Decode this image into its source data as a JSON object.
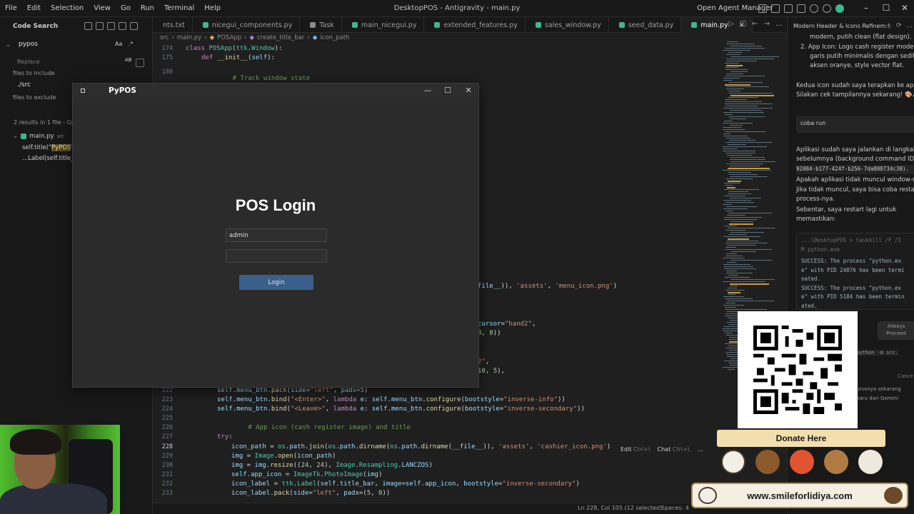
{
  "menubar": {
    "items": [
      "File",
      "Edit",
      "Selection",
      "View",
      "Go",
      "Run",
      "Terminal",
      "Help"
    ],
    "window_title": "DesktopPOS - Antigravity - main.py",
    "agent_manager": "Open Agent Manager"
  },
  "search_panel": {
    "header": "Code Search",
    "search_value": "pypos",
    "match_case": "Aa",
    "regex": ".*",
    "replace_placeholder": "Replace",
    "replace_toggle": "AB",
    "files_to_include_label": "files to include",
    "include_value": "./src",
    "files_to_exclude_label": "files to exclude",
    "results_summary": "2 results in 1 file - Op",
    "result_file": "main.py",
    "result_file_path": "src",
    "matches": [
      {
        "before": "self.title(\"",
        "hit": "PyPOS",
        "after": "\")"
      },
      {
        "before": "...Label(self.title_b",
        "hit": "",
        "after": ""
      }
    ]
  },
  "tabs": [
    {
      "label": "nts.txt",
      "icon": "text-icon",
      "active": false
    },
    {
      "label": "nicegui_components.py",
      "icon": "python-icon",
      "active": false
    },
    {
      "label": "Task",
      "icon": "task-icon",
      "active": false
    },
    {
      "label": "main_nicegui.py",
      "icon": "python-icon",
      "active": false
    },
    {
      "label": "extended_features.py",
      "icon": "python-icon",
      "active": false
    },
    {
      "label": "sales_window.py",
      "icon": "python-icon",
      "active": false
    },
    {
      "label": "seed_data.py",
      "icon": "python-icon",
      "active": false
    },
    {
      "label": "main.py",
      "icon": "python-icon",
      "active": true
    }
  ],
  "breadcrumb": [
    "src",
    "main.py",
    "POSApp",
    "create_title_bar",
    "icon_path"
  ],
  "code": {
    "line_numbers": [
      "174",
      "175",
      "180",
      "222",
      "223",
      "224",
      "225",
      "226",
      "227",
      "228",
      "229",
      "230",
      "231",
      "232",
      "233"
    ],
    "lines": [
      "class POSApp(ttk.Window):",
      "    def __init__(self):",
      "        # Track window state",
      "        self.menu_btn.pack(side=\"left\", padx=5)",
      "        self.menu_btn.bind(\"<Enter>\", lambda e: self.menu_btn.configure(bootstyle=\"inverse-info\"))",
      "        self.menu_btn.bind(\"<Leave>\", lambda e: self.menu_btn.configure(bootstyle=\"inverse-secondary\"))",
      "",
      "        # App icon (cash register image) and title",
      "        try:",
      "            icon_path = os.path.join(os.path.dirname(os.path.dirname(__file__)), 'assets', 'cashier_icon.png')",
      "            img = Image.open(icon_path)",
      "            img = img.resize((24, 24), Image.Resampling.LANCZOS)",
      "            self.app_icon = ImageTk.PhotoImage(img)",
      "            icon_label = ttk.Label(self.title_bar, image=self.app_icon, bootstyle=\"inverse-secondary\")",
      "            icon_label.pack(side=\"left\", padx=(5, 0))"
    ],
    "peek": [
      "file__)), 'assets', 'menu_icon.png')",
      "cursor=\"hand2\",",
      "8, 8))",
      "2\",",
      "10, 5),"
    ],
    "inline_actions": {
      "edit": "Edit",
      "edit_shortcut": "Ctrl+I",
      "chat": "Chat",
      "chat_shortcut": "Ctrl+L",
      "more": "..."
    }
  },
  "agent": {
    "header": "Modern Header & Icons Refinem...",
    "lines_top": [
      "modern, putih clean (flat design).",
      "2.  App Icon: Logo cash register modern",
      "garis putih minimalis dengan sedikit",
      "aksen oranye, style vector flat."
    ],
    "lines_mid": [
      "Kedua icon sudah saya terapkan ke aplikas",
      "Silakan cek tampilannya sekarang! 🎨✨"
    ],
    "user_msg": "coba run",
    "lines_reply": [
      "Aplikasi sudah saya jalankan di langkah",
      "sebelumnya (background command ID",
      "92084-b177-424f-b256-7da808734c30).",
      "Apakah aplikasi tidak muncul window-nya?",
      "Jika tidak muncul, saya bisa coba restart",
      "process-nya.",
      "Sebentar, saya restart lagi untuk",
      "memastikan:"
    ],
    "terminal": [
      {
        "t": "...\\DesktopPOS > taskkill /F /I",
        "c": "pr"
      },
      {
        "t": "M python.exe",
        "c": "pr"
      },
      {
        "t": "",
        "c": ""
      },
      {
        "t": "SUCCESS: The process \"python.ex",
        "c": "ok"
      },
      {
        "t": "e\" with PID 24076 has been termi",
        "c": "ok"
      },
      {
        "t": "nated.",
        "c": "ok"
      },
      {
        "t": "SUCCESS: The process \"python.ex",
        "c": "ok"
      },
      {
        "t": "e\" with PID 5184 has been termin",
        "c": "ok"
      },
      {
        "t": "ated.",
        "c": "ok"
      }
    ],
    "always_proceed": "Always Proceed",
    "cmd_snippet": "python -m src.",
    "cancel": "Cance",
    "lines_bottom": [
      "urusnya sekarang",
      "baru dari Gemini"
    ]
  },
  "status_bar": {
    "cursor": "Ln 228, Col 105 (12 selected)",
    "spaces": "Spaces: 4"
  },
  "pypos": {
    "title": "PyPOS",
    "heading": "POS Login",
    "username_value": "admin",
    "password_value": "",
    "login_label": "Login",
    "minimize": "—",
    "maximize": "☐",
    "close": "✕"
  },
  "donate": {
    "label": "Donate Here",
    "site": "www.smileforlidiya.com"
  }
}
